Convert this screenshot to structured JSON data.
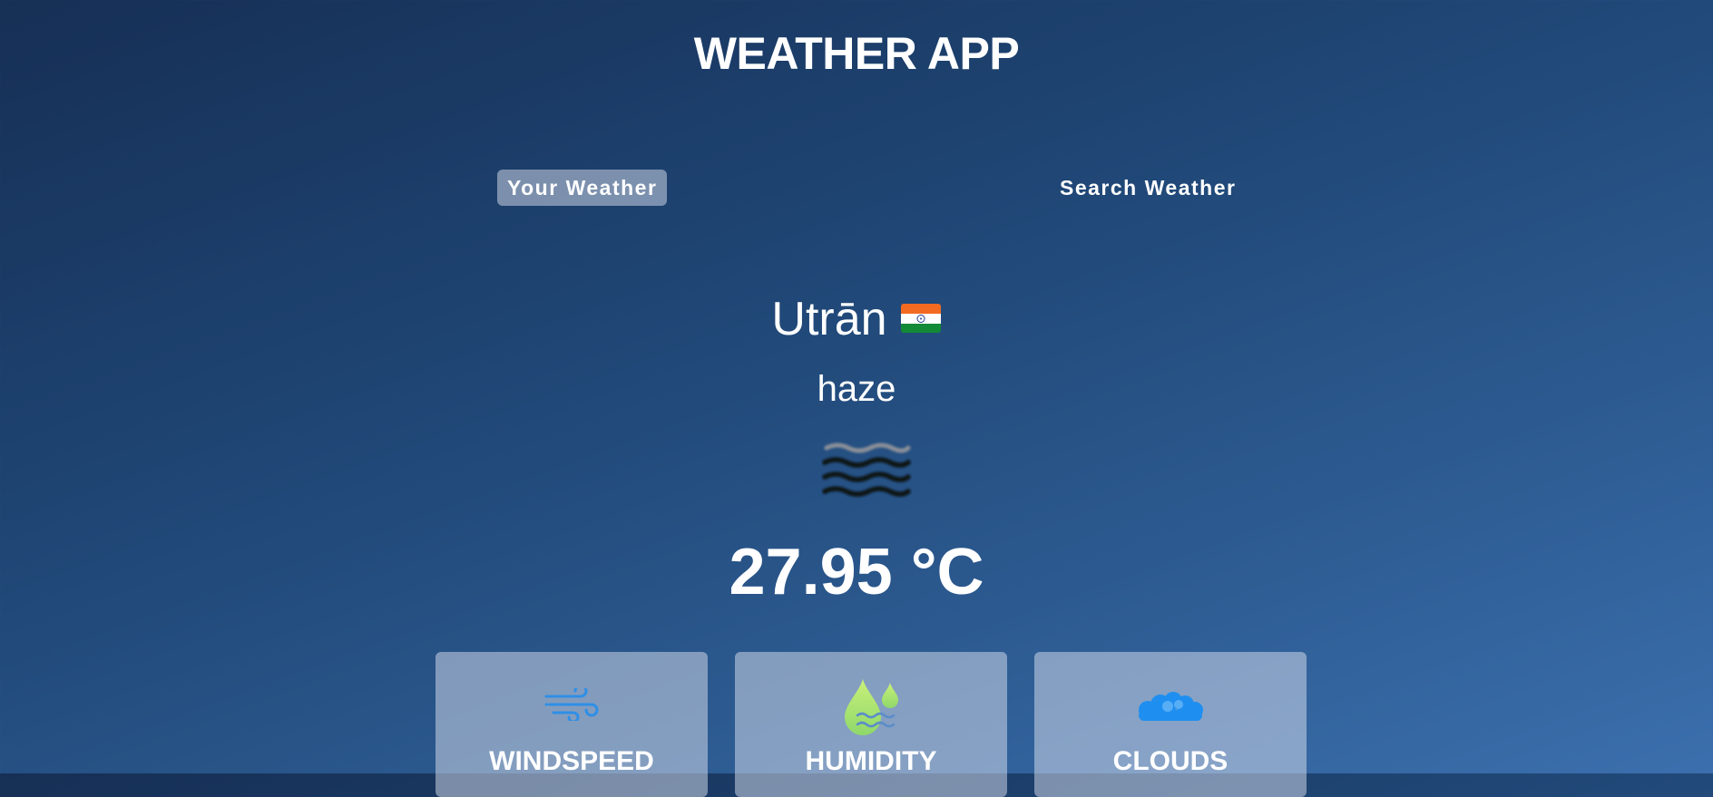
{
  "app": {
    "title": "WEATHER APP"
  },
  "tabs": [
    {
      "label": "Your Weather",
      "active": true
    },
    {
      "label": "Search Weather",
      "active": false
    }
  ],
  "weather": {
    "city": "Utrān",
    "country_flag_icon": "india-flag-icon",
    "description": "haze",
    "condition_icon": "haze-icon",
    "temperature": "27.95 °C"
  },
  "cards": [
    {
      "label": "WINDSPEED",
      "icon": "wind-icon",
      "color": "#2f8fe6"
    },
    {
      "label": "HUMIDITY",
      "icon": "humidity-icon",
      "color": "#a6e36a"
    },
    {
      "label": "CLOUDS",
      "icon": "cloud-icon",
      "color": "#1e8ff0"
    }
  ],
  "colors": {
    "background_top": "#162f55",
    "background_bottom": "#3b6fad",
    "panel": "#dbe2ef"
  }
}
